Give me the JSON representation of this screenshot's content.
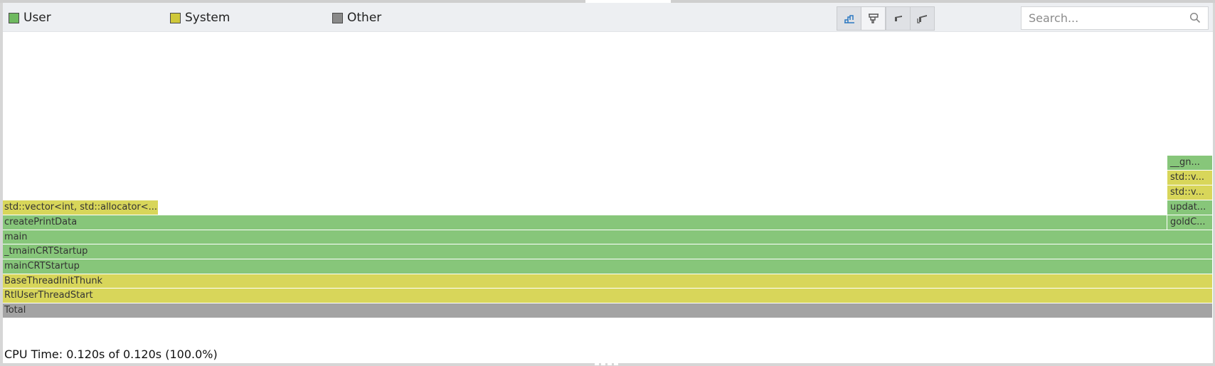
{
  "legend": [
    {
      "label": "User",
      "color": "#6fb960"
    },
    {
      "label": "System",
      "color": "#cfc83a"
    },
    {
      "label": "Other",
      "color": "#8a8a8a"
    }
  ],
  "toolbar": {
    "buttons": [
      "flame-graph-icon",
      "icicle-graph-icon",
      "back-icon",
      "reset-zoom-icon"
    ],
    "search_placeholder": "Search..."
  },
  "frames": [
    {
      "label": "Total",
      "category": "other"
    },
    {
      "label": "RtlUserThreadStart",
      "category": "system"
    },
    {
      "label": "BaseThreadInitThunk",
      "category": "system"
    },
    {
      "label": "mainCRTStartup",
      "category": "user"
    },
    {
      "label": "_tmainCRTStartup",
      "category": "user"
    },
    {
      "label": "main",
      "category": "user"
    },
    {
      "label": "createPrintData",
      "category": "user"
    },
    {
      "label": "std::vector<int, std::allocator<...",
      "category": "system"
    },
    {
      "label": "goldC...",
      "category": "user"
    },
    {
      "label": "updat...",
      "category": "user"
    },
    {
      "label": "std::v...",
      "category": "system"
    },
    {
      "label": "std::v...",
      "category": "system"
    },
    {
      "label": "__gn...",
      "category": "user"
    }
  ],
  "status": {
    "text": "CPU Time: 0.120s of 0.120s (100.0%)"
  }
}
